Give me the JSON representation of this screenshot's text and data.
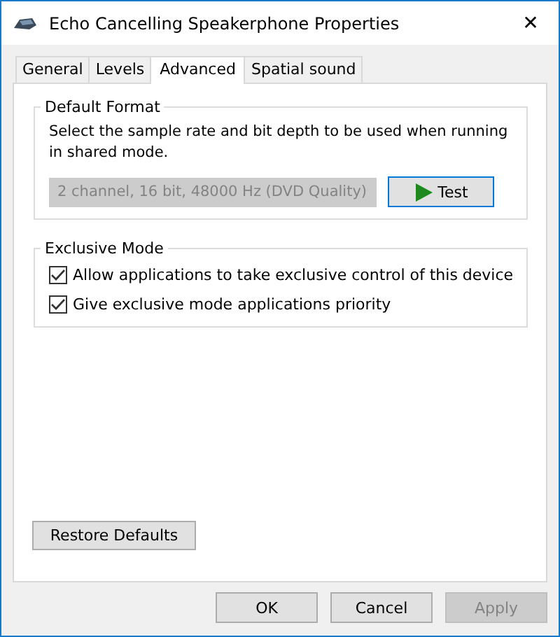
{
  "window": {
    "title": "Echo Cancelling Speakerphone Properties",
    "close": "✕"
  },
  "tabs": [
    {
      "label": "General",
      "selected": false
    },
    {
      "label": "Levels",
      "selected": false
    },
    {
      "label": "Advanced",
      "selected": true
    },
    {
      "label": "Spatial sound",
      "selected": false
    }
  ],
  "default_format": {
    "title": "Default Format",
    "description": "Select the sample rate and bit depth to be used when running in shared mode.",
    "format": {
      "value": "2 channel, 16 bit, 48000 Hz (DVD Quality)",
      "disabled": true
    },
    "test_button": "Test"
  },
  "exclusive_mode": {
    "title": "Exclusive Mode",
    "options": [
      {
        "label": "Allow applications to take exclusive control of this device",
        "checked": true
      },
      {
        "label": "Give exclusive mode applications priority",
        "checked": true
      }
    ]
  },
  "restore_button": "Restore Defaults",
  "buttons": [
    {
      "label": "OK",
      "disabled": false
    },
    {
      "label": "Cancel",
      "disabled": false
    },
    {
      "label": "Apply",
      "disabled": true
    }
  ]
}
